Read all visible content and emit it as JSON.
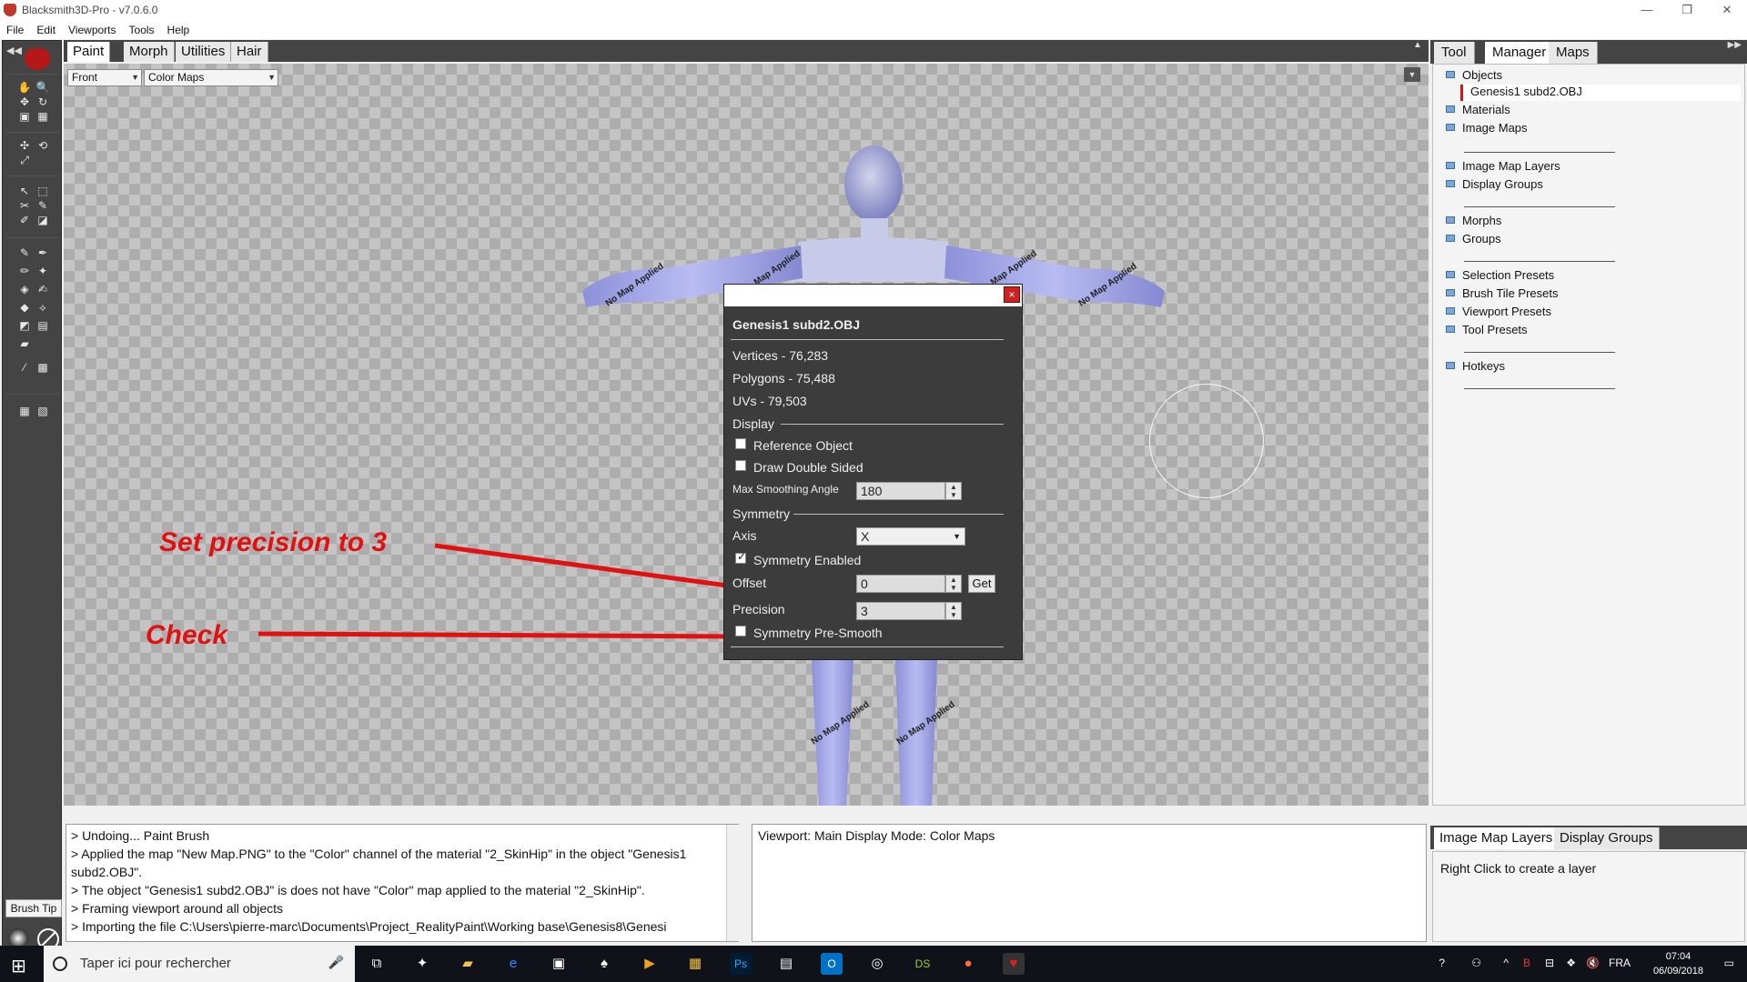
{
  "app": {
    "title": "Blacksmith3D-Pro - v7.0.6.0"
  },
  "window_controls": [
    "—",
    "❐",
    "✕"
  ],
  "menu": [
    "File",
    "Edit",
    "Viewports",
    "Tools",
    "Help"
  ],
  "viewport_tabs": [
    "Paint",
    "Morph",
    "Utilities",
    "Hair"
  ],
  "viewport_toolbar": {
    "view_select": "Front",
    "mode_select": "Color Maps"
  },
  "right_tabs": [
    "Tool",
    "Manager",
    "Maps"
  ],
  "manager": {
    "objects_label": "Objects",
    "selected_object": "Genesis1 subd2.OBJ",
    "groups": [
      [
        "Materials",
        "Image Maps"
      ],
      [
        "Image Map Layers",
        "Display Groups"
      ],
      [
        "Morphs",
        "Groups"
      ],
      [
        "Selection Presets",
        "Brush Tile Presets",
        "Viewport Presets",
        "Tool Presets"
      ],
      [
        "Hotkeys"
      ]
    ]
  },
  "dialog": {
    "title": "Genesis1 subd2.OBJ",
    "close_label": "×",
    "vertices": "Vertices - 76,283",
    "polygons": "Polygons - 75,488",
    "uvs": "UVs - 79,503",
    "display_section": "Display",
    "reference_object": "Reference Object",
    "reference_object_checked": false,
    "draw_double_sided": "Draw Double Sided",
    "draw_double_sided_checked": false,
    "max_smoothing_label": "Max Smoothing Angle",
    "max_smoothing_value": "180",
    "symmetry_section": "Symmetry",
    "axis_label": "Axis",
    "axis_value": "X",
    "symmetry_enabled": "Symmetry Enabled",
    "symmetry_enabled_checked": true,
    "offset_label": "Offset",
    "offset_value": "0",
    "get_button": "Get",
    "precision_label": "Precision",
    "precision_value": "3",
    "pre_smooth": "Symmetry Pre-Smooth",
    "pre_smooth_checked": false
  },
  "annotations": {
    "precision": "Set precision to 3",
    "check": "Check",
    "color": "#e11111"
  },
  "figure_sign": "No Map Applied",
  "log": [
    "> Undoing... Paint Brush",
    "> Applied the map \"New Map.PNG\" to the \"Color\" channel of the material \"2_SkinHip\" in the object \"Genesis1 subd2.OBJ\".",
    "> The object \"Genesis1 subd2.OBJ\" is does not have \"Color\" map applied to the material \"2_SkinHip\".",
    "> Framing viewport around all objects",
    "> Importing the file C:\\Users\\pierre-marc\\Documents\\Project_RealityPaint\\Working base\\Genesis8\\Genesi"
  ],
  "status": "Viewport: Main Display Mode: Color Maps",
  "bottom_right_tabs": [
    "Image Map Layers",
    "Display Groups"
  ],
  "layers_hint": "Right Click to create a layer",
  "brush_tip_label": "Brush Tip",
  "taskbar": {
    "search_placeholder": "Taper ici pour rechercher",
    "language": "FRA",
    "time": "07:04",
    "date": "06/09/2018"
  }
}
